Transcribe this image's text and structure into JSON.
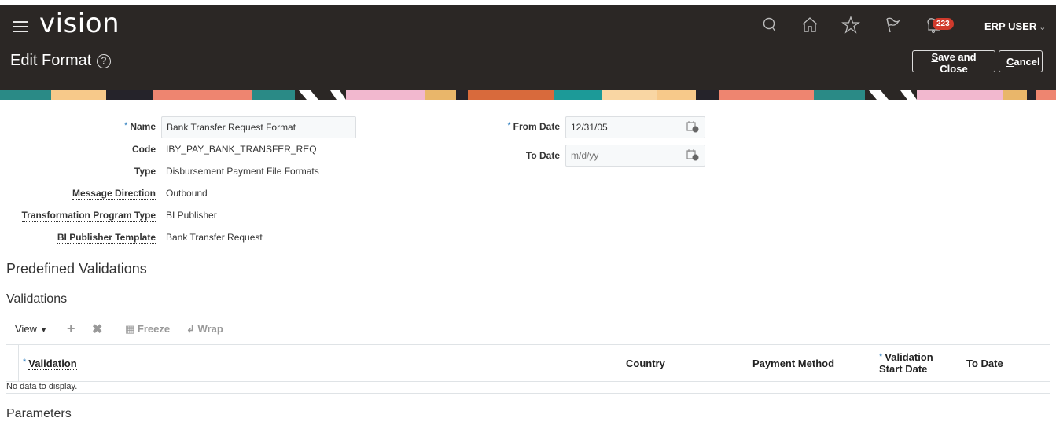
{
  "app": {
    "logo": "vision",
    "page_title": "Edit Format",
    "notification_count": "223",
    "user": "ERP USER",
    "icons": [
      "menu-icon",
      "search-icon",
      "home-icon",
      "star-icon",
      "flag-icon",
      "bell-icon",
      "help-icon"
    ]
  },
  "actions": {
    "save_close": {
      "prefix": "S",
      "rest": "ave and Close"
    },
    "cancel": {
      "prefix": "C",
      "rest": "ancel"
    }
  },
  "form": {
    "name": {
      "label": "Name",
      "required": true,
      "value": "Bank Transfer Request Format"
    },
    "code": {
      "label": "Code",
      "value": "IBY_PAY_BANK_TRANSFER_REQ"
    },
    "type": {
      "label": "Type",
      "value": "Disbursement Payment File Formats"
    },
    "message_direction": {
      "label": "Message Direction",
      "value": "Outbound"
    },
    "transformation_program_type": {
      "label": "Transformation Program Type",
      "value": "BI Publisher"
    },
    "bi_publisher_template": {
      "label": "BI Publisher Template",
      "value": "Bank Transfer Request"
    },
    "from_date": {
      "label": "From Date",
      "required": true,
      "value": "12/31/05"
    },
    "to_date": {
      "label": "To Date",
      "value": "",
      "placeholder": "m/d/yy"
    }
  },
  "sections": {
    "predefined_validations": "Predefined Validations",
    "validations": "Validations",
    "parameters": "Parameters"
  },
  "toolbar": {
    "view": "View",
    "freeze": "Freeze",
    "wrap": "Wrap"
  },
  "table": {
    "columns": [
      {
        "label": "Validation",
        "required": true
      },
      {
        "label": "Country"
      },
      {
        "label": "Payment Method"
      },
      {
        "label": "Validation Start Date",
        "line1": "Validation",
        "line2": "Start Date",
        "required": true
      },
      {
        "label": "To Date"
      }
    ],
    "rows": [],
    "empty_text": "No data to display."
  }
}
